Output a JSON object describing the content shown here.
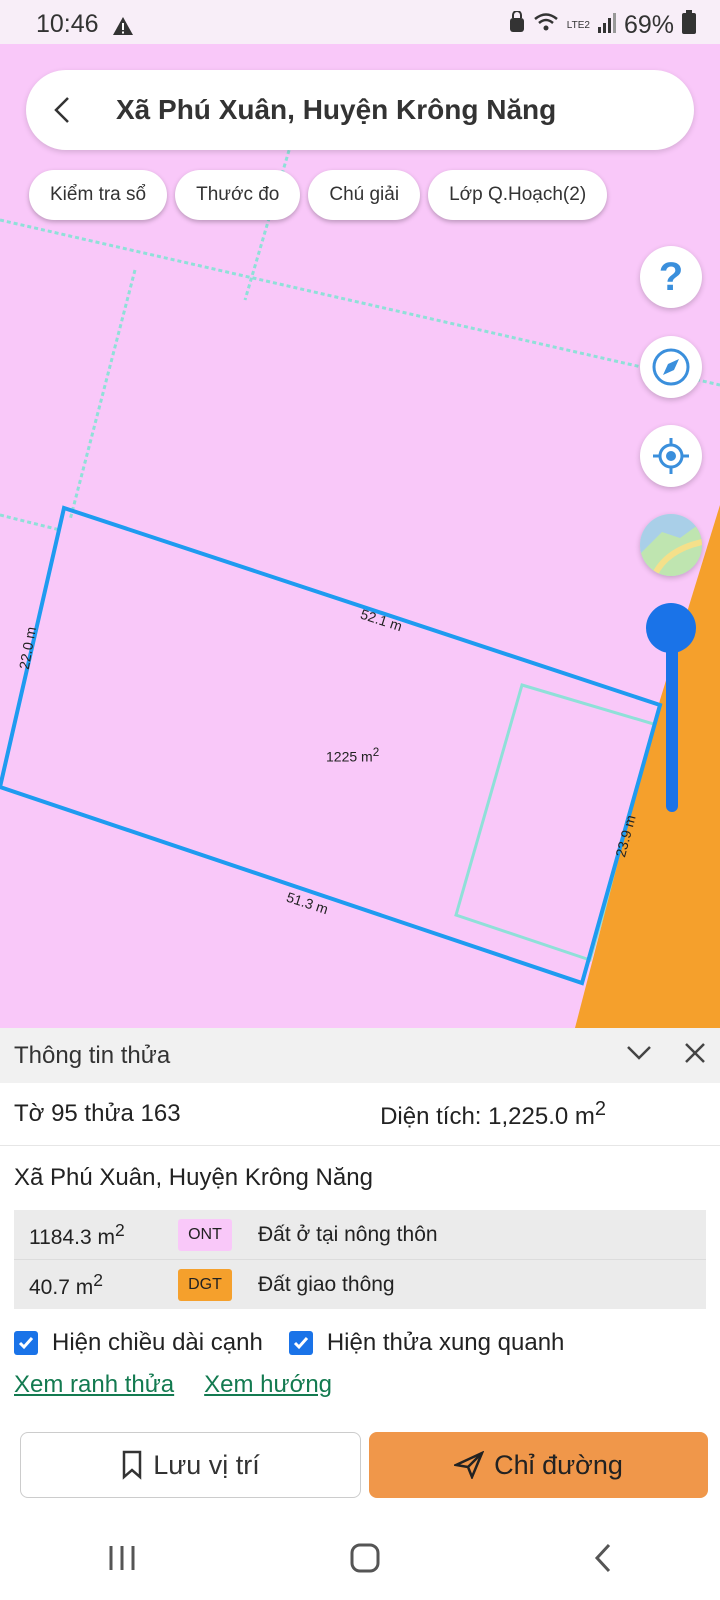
{
  "status_bar": {
    "time": "10:46",
    "battery": "69%",
    "network": "LTE2"
  },
  "header": {
    "title": "Xã Phú Xuân, Huyện Krông Năng"
  },
  "chips": [
    {
      "label": "Kiểm tra sổ"
    },
    {
      "label": "Thước đo"
    },
    {
      "label": "Chú giải"
    },
    {
      "label": "Lớp Q.Hoạch(2)"
    }
  ],
  "map": {
    "edges": {
      "top": "52.1 m",
      "left": "22.0 m",
      "right": "23.9 m",
      "bottom": "51.3 m"
    },
    "area_value": "1225 m",
    "area_sup": "2"
  },
  "panel": {
    "title": "Thông tin thửa",
    "parcel": "Tờ 95 thửa 163",
    "area_label": "Diện tích: 1,225.0 m",
    "area_sup": "2",
    "address": "Xã Phú Xuân, Huyện Krông Năng",
    "land_uses": [
      {
        "area": "1184.3 m",
        "sup": "2",
        "code": "ONT",
        "name": "Đất ở tại nông thôn",
        "color": "#f9c8f9"
      },
      {
        "area": "40.7 m",
        "sup": "2",
        "code": "DGT",
        "name": "Đất giao thông",
        "color": "#f5a02c"
      }
    ],
    "checkbox_edges": "Hiện chiều dài cạnh",
    "checkbox_surrounding": "Hiện thửa xung quanh",
    "link_boundary": "Xem ranh thửa",
    "link_direction": "Xem hướng",
    "save_label": "Lưu vị trí",
    "route_label": "Chỉ đường"
  },
  "colors": {
    "map_bg": "#f9c8f9",
    "parcel_border": "#1f9bf0",
    "road": "#f5a02c",
    "accent": "#1a73e8",
    "route_button": "#f0974a"
  }
}
